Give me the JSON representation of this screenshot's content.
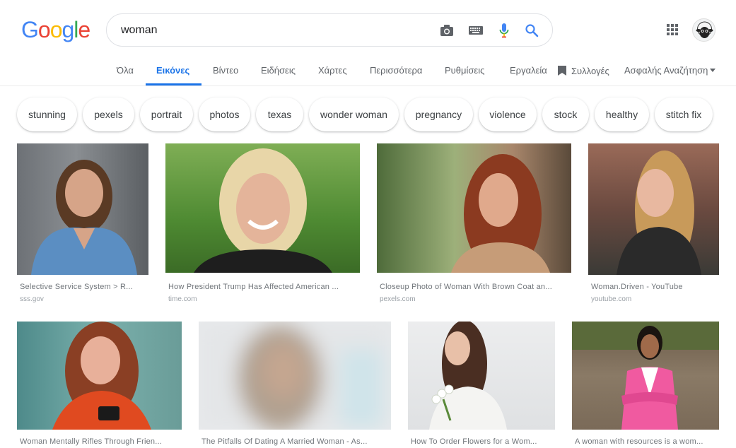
{
  "logo": {
    "letters": [
      "G",
      "o",
      "o",
      "g",
      "l",
      "e"
    ],
    "colors": [
      "#4285f4",
      "#ea4335",
      "#fbbc05",
      "#4285f4",
      "#34a853",
      "#ea4335"
    ]
  },
  "search": {
    "value": "woman",
    "placeholder": ""
  },
  "icons": {
    "camera": "camera-icon",
    "keyboard": "keyboard-icon",
    "mic": "mic-icon",
    "search": "search-icon",
    "apps": "apps-grid-icon",
    "avatar": "sheep-avatar"
  },
  "tabs": [
    {
      "label": "Όλα"
    },
    {
      "label": "Εικόνες",
      "active": true
    },
    {
      "label": "Βίντεο"
    },
    {
      "label": "Ειδήσεις"
    },
    {
      "label": "Χάρτες"
    },
    {
      "label": "Περισσότερα"
    },
    {
      "label": "Ρυθμίσεις"
    },
    {
      "label": "Εργαλεία"
    },
    {
      "label": "Συλλογές"
    },
    {
      "label": "Ασφαλής Αναζήτηση"
    }
  ],
  "chips": [
    "stunning",
    "pexels",
    "portrait",
    "photos",
    "texas",
    "wonder woman",
    "pregnancy",
    "violence",
    "stock",
    "healthy",
    "stitch fix"
  ],
  "results": [
    {
      "caption": "Selective Service System > R...",
      "source": "sss.gov"
    },
    {
      "caption": "How President Trump Has Affected American ...",
      "source": "time.com"
    },
    {
      "caption": "Closeup Photo of Woman With Brown Coat an...",
      "source": "pexels.com"
    },
    {
      "caption": "Woman.Driven - YouTube",
      "source": "youtube.com"
    },
    {
      "caption": "Woman Mentally Rifles Through Frien...",
      "source": ""
    },
    {
      "caption": "The Pitfalls Of Dating A Married Woman - As...",
      "source": ""
    },
    {
      "caption": "How To Order Flowers for a Wom...",
      "source": ""
    },
    {
      "caption": "A woman with resources is a wom...",
      "source": ""
    }
  ],
  "colors": {
    "accent": "#1a73e8",
    "mic_blue": "#4285f4",
    "mic_red": "#ea4335"
  }
}
